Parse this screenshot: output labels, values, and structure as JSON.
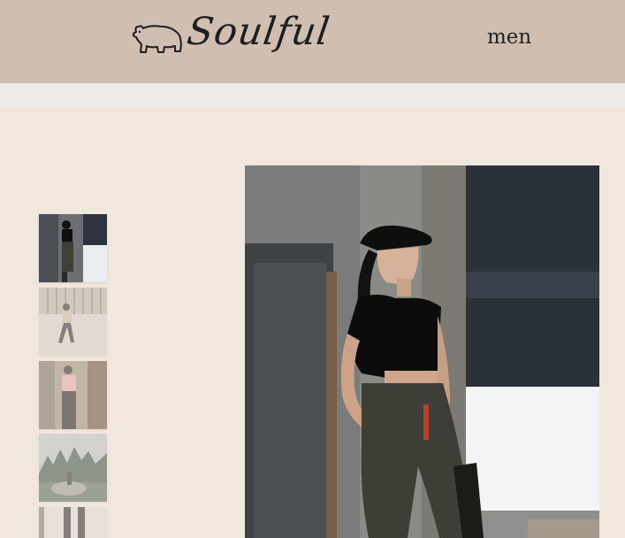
{
  "header": {
    "brand": "Soulful",
    "logo_icon": "bear-icon",
    "nav_item": "men"
  },
  "gallery": {
    "thumbnails": [
      {
        "name": "thumbnail-1",
        "selected": true
      },
      {
        "name": "thumbnail-2",
        "selected": false
      },
      {
        "name": "thumbnail-3",
        "selected": false
      },
      {
        "name": "thumbnail-4",
        "selected": false
      },
      {
        "name": "thumbnail-5",
        "selected": false
      }
    ]
  },
  "colors": {
    "header_bg": "#d0bfb1",
    "page_bg": "#f2e7dd"
  }
}
